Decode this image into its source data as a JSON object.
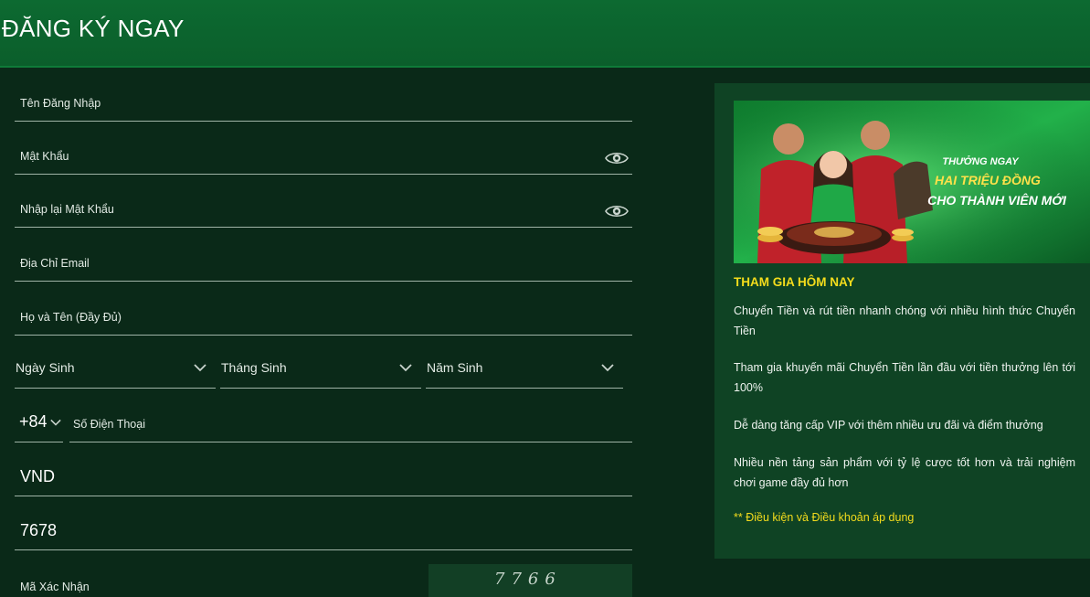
{
  "header": {
    "title": "ĐĂNG KÝ NGAY"
  },
  "form": {
    "username_label": "Tên Đăng Nhập",
    "password_label": "Mật Khẩu",
    "password_confirm_label": "Nhập lại Mật Khẩu",
    "email_label": "Địa Chỉ Email",
    "fullname_label": "Họ và Tên (Đầy Đủ)",
    "birth_day_label": "Ngày Sinh",
    "birth_month_label": "Tháng Sinh",
    "birth_year_label": "Năm Sinh",
    "phone_code": "+84",
    "phone_label": "Số Điện Thoại",
    "currency_value": "VND",
    "code_value": "7678",
    "captcha_label": "Mã Xác Nhận",
    "captcha_code": "7766"
  },
  "promo": {
    "banner": {
      "line1": "THƯỞNG NGAY",
      "line2": "HAI TRIỆU ĐỒNG",
      "line3": "CHO THÀNH VIÊN MỚI"
    },
    "title": "THAM GIA HÔM NAY",
    "paragraphs": [
      "Chuyển Tiền và rút tiền nhanh chóng với nhiều hình thức Chuyển Tiền",
      "Tham gia khuyến mãi Chuyển Tiền lần đầu với tiền thưởng lên tới 100%",
      "Dễ dàng tăng cấp VIP với thêm nhiều ưu đãi và điểm thưởng",
      "Nhiều nền tảng sản phẩm với tỷ lệ cược tốt hơn và trải nghiệm chơi game đầy đủ hơn"
    ],
    "terms": "** Điều kiện và Điều khoản áp dụng"
  },
  "colors": {
    "header_bg": "#0d6a31",
    "page_bg": "#0a2918",
    "panel_bg": "#0f4324",
    "accent_yellow": "#f4dc1c"
  },
  "icons": {
    "password_toggle": "eye-icon",
    "dropdown": "chevron-down-icon"
  }
}
